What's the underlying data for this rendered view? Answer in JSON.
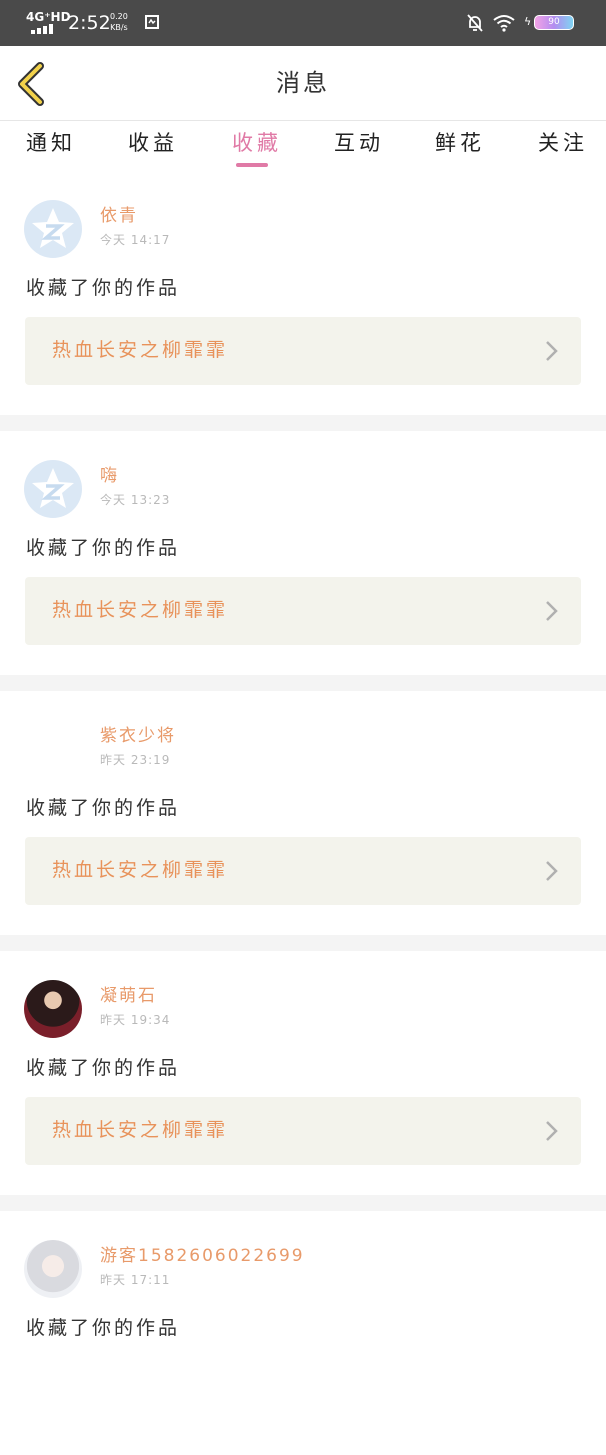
{
  "status_bar": {
    "network": "4G⁺HD",
    "time": "2:52",
    "speed_value": "0.20",
    "speed_unit": "KB/s",
    "battery": "90"
  },
  "header": {
    "title": "消息"
  },
  "tabs": [
    {
      "label": "通知"
    },
    {
      "label": "收益"
    },
    {
      "label": "收藏"
    },
    {
      "label": "互动"
    },
    {
      "label": "鲜花"
    },
    {
      "label": "关注"
    }
  ],
  "active_tab": "收藏",
  "colors": {
    "accent": "#e07aa6",
    "username": "#e89a6a",
    "work_title": "#e8925a",
    "card_bg": "#f3f3ec"
  },
  "messages": [
    {
      "username": "依青",
      "date": "今天 14:17",
      "action": "收藏了你的作品",
      "work": "热血长安之柳霏霏",
      "avatar": "qq-placeholder"
    },
    {
      "username": "嗨",
      "date": "今天 13:23",
      "action": "收藏了你的作品",
      "work": "热血长安之柳霏霏",
      "avatar": "qq-placeholder"
    },
    {
      "username": "紫衣少将",
      "date": "昨天 23:19",
      "action": "收藏了你的作品",
      "work": "热血长安之柳霏霏",
      "avatar": "none"
    },
    {
      "username": "凝萌石",
      "date": "昨天 19:34",
      "action": "收藏了你的作品",
      "work": "热血长安之柳霏霏",
      "avatar": "photo"
    },
    {
      "username": "游客1582606022699",
      "date": "昨天 17:11",
      "action": "收藏了你的作品",
      "work": "",
      "avatar": "photo"
    }
  ]
}
